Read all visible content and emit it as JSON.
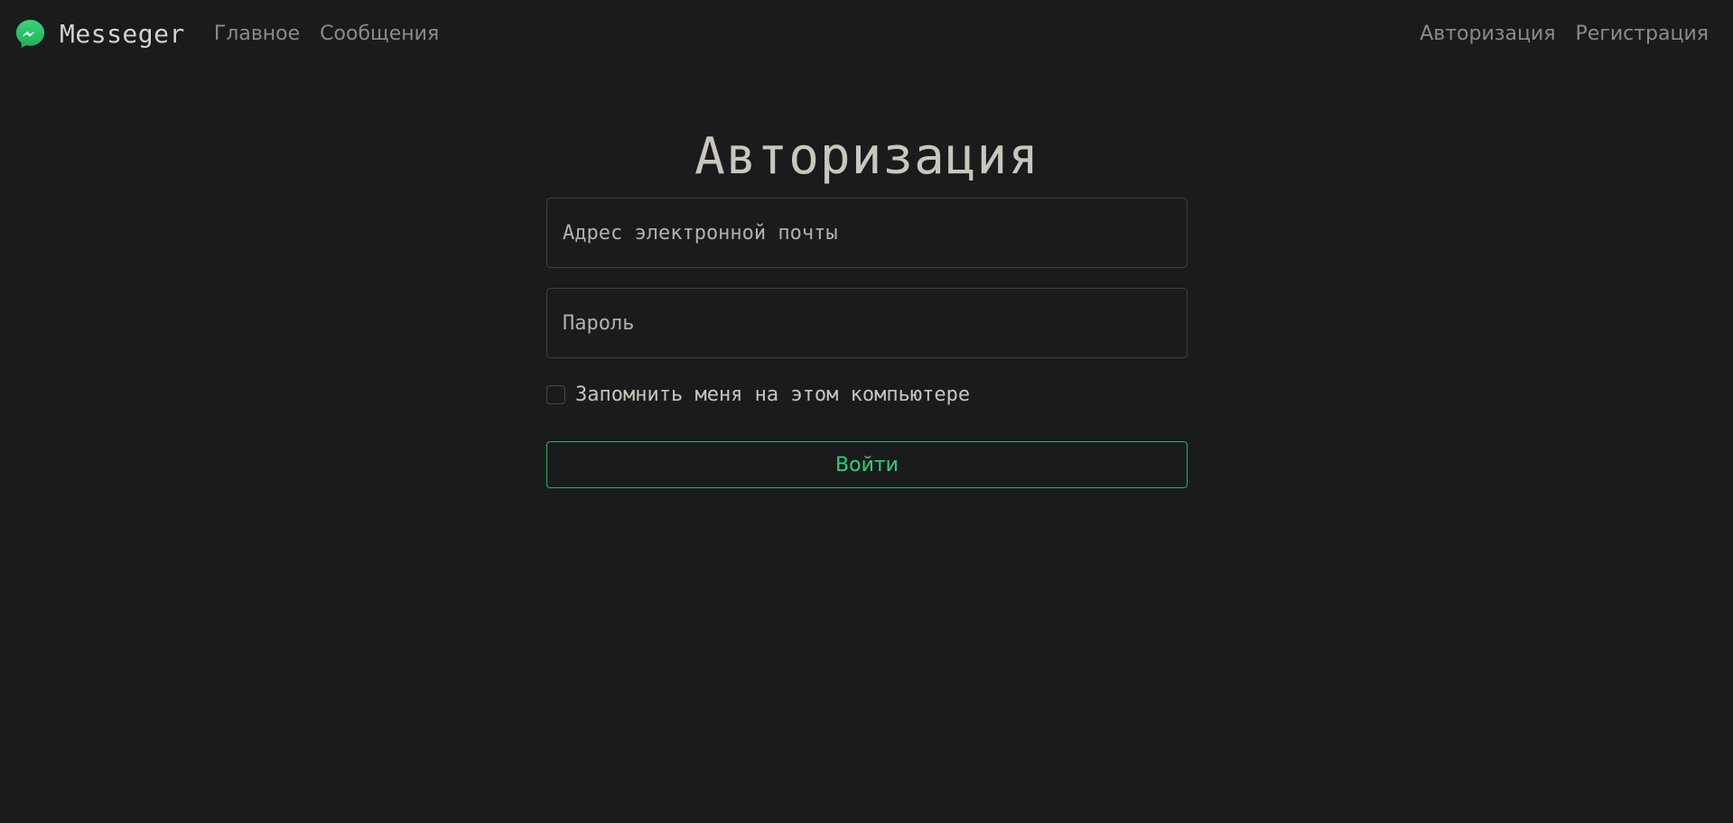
{
  "navbar": {
    "brand": {
      "name": "Messeger",
      "icon": "messenger-icon"
    },
    "left_links": [
      {
        "label": "Главное"
      },
      {
        "label": "Сообщения"
      }
    ],
    "right_links": [
      {
        "label": "Авторизация"
      },
      {
        "label": "Регистрация"
      }
    ]
  },
  "auth": {
    "title": "Авторизация",
    "email": {
      "placeholder": "Адрес электронной почты",
      "value": ""
    },
    "password": {
      "placeholder": "Пароль",
      "value": ""
    },
    "remember": {
      "label": "Запомнить меня на этом компьютере",
      "checked": false
    },
    "submit_label": "Войти"
  },
  "colors": {
    "background": "#1a1b1d",
    "accent": "#2fcf7b",
    "logo_green": "#2ecc71"
  }
}
